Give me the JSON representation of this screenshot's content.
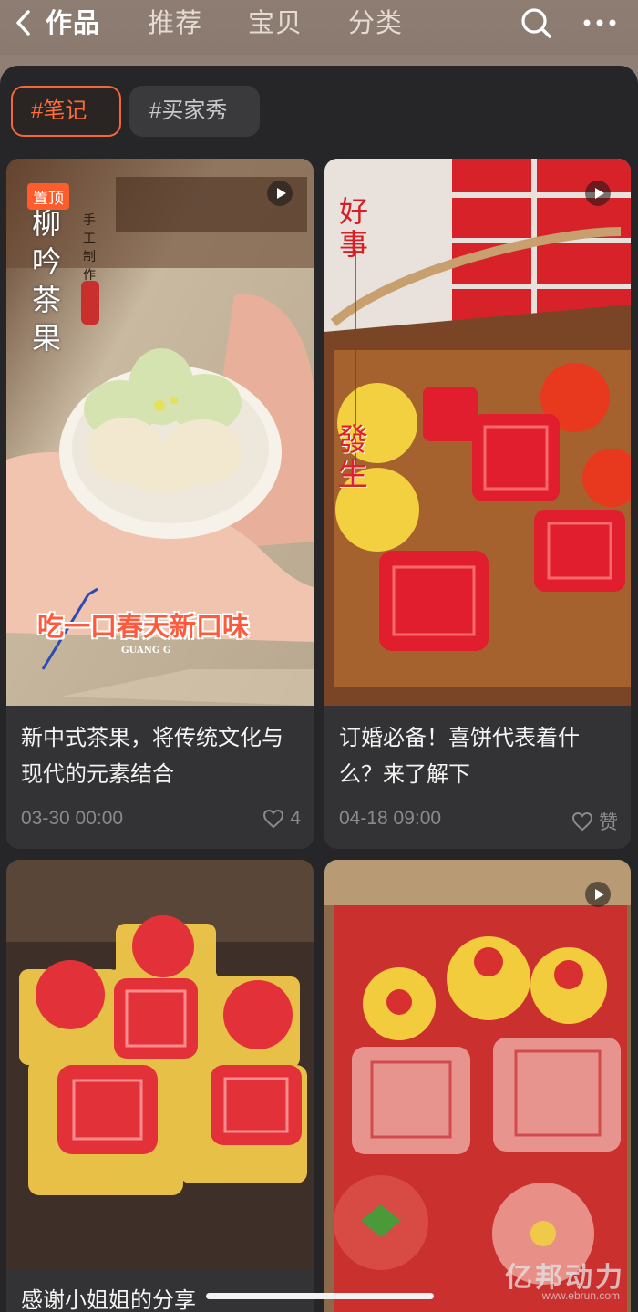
{
  "header": {
    "tabs": [
      "作品",
      "推荐",
      "宝贝",
      "分类"
    ],
    "icons": [
      "back-icon",
      "search-icon",
      "more-icon"
    ]
  },
  "filters": [
    {
      "label": "#笔记",
      "selected": true
    },
    {
      "label": "#买家秀",
      "selected": false
    }
  ],
  "posts": [
    {
      "title": "新中式茶果，将传统文化与现代的元素结合",
      "date": "03-30 00:00",
      "likes": "4",
      "pinned_label": "置顶",
      "image_text": {
        "vertical_title": "柳吟茶果",
        "side_text": "手工制作",
        "caption": "吃一口春天新口味",
        "brand": "GUANG G"
      }
    },
    {
      "title": "订婚必备！喜饼代表着什么？来了解下",
      "date": "04-18 09:00",
      "likes": "赞",
      "image_text": {
        "top": "好事",
        "bottom": "發生"
      }
    },
    {
      "title": "感谢小姐姐的分享"
    },
    {
      "title": ""
    }
  ],
  "watermark": {
    "main": "亿邦动力",
    "url": "www.ebrun.com"
  },
  "colors": {
    "accent": "#ff6b3a",
    "panel": "#262628",
    "card": "#333335",
    "header": "#8d7d72"
  }
}
